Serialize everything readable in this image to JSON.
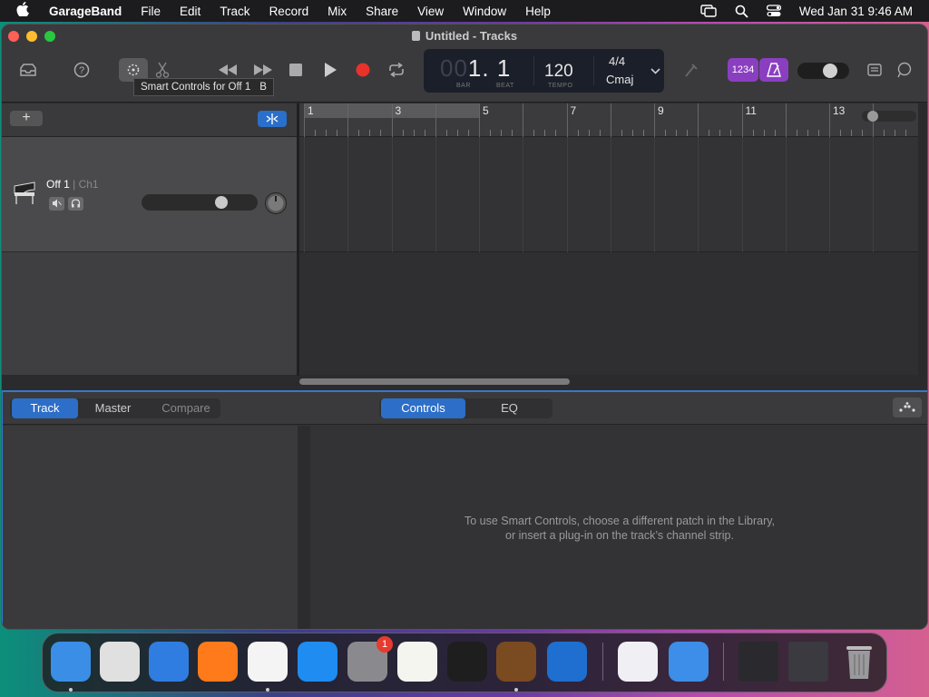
{
  "menubar": {
    "app_name": "GarageBand",
    "items": [
      "File",
      "Edit",
      "Track",
      "Record",
      "Mix",
      "Share",
      "View",
      "Window",
      "Help"
    ],
    "datetime": "Wed Jan 31  9:46 AM"
  },
  "window": {
    "title": "Untitled - Tracks"
  },
  "tooltip": {
    "text": "Smart Controls for Off 1",
    "shortcut": "B"
  },
  "lcd": {
    "position_dim": "00",
    "position": "1. 1",
    "bar_label": "BAR",
    "beat_label": "BEAT",
    "tempo": "120",
    "tempo_label": "TEMPO",
    "time_signature": "4/4",
    "key": "Cmaj"
  },
  "count_in_label": "1234",
  "ruler": {
    "bars": [
      "1",
      "3",
      "5",
      "7",
      "9",
      "11",
      "13"
    ]
  },
  "track": {
    "name": "Off 1",
    "channel": "| Ch1",
    "volume_level": 0.72
  },
  "smart_controls": {
    "tabs_left": [
      "Track",
      "Master",
      "Compare"
    ],
    "tabs_right": [
      "Controls",
      "EQ"
    ],
    "message_line1": "To use Smart Controls, choose a different patch in the Library,",
    "message_line2": "or insert a plug-in on the track’s channel strip."
  },
  "dock": {
    "apps": [
      {
        "name": "finder",
        "color": "#3a8ee6"
      },
      {
        "name": "launchpad",
        "color": "#e0e0e0"
      },
      {
        "name": "safari",
        "color": "#2f7de1"
      },
      {
        "name": "firefox",
        "color": "#ff7a1a"
      },
      {
        "name": "chrome",
        "color": "#f4f4f4"
      },
      {
        "name": "app-store",
        "color": "#1e8cf0"
      },
      {
        "name": "system-settings",
        "color": "#8a8a8e"
      },
      {
        "name": "textedit",
        "color": "#f5f5f0"
      },
      {
        "name": "terminal",
        "color": "#1e1e1e"
      },
      {
        "name": "garageband",
        "color": "#7a4a20"
      },
      {
        "name": "vscode",
        "color": "#1e6fd0"
      },
      {
        "name": "visual-studio",
        "color": "#f0f0f4"
      },
      {
        "name": "weather",
        "color": "#3c8ee8"
      }
    ],
    "settings_badge": "1"
  }
}
